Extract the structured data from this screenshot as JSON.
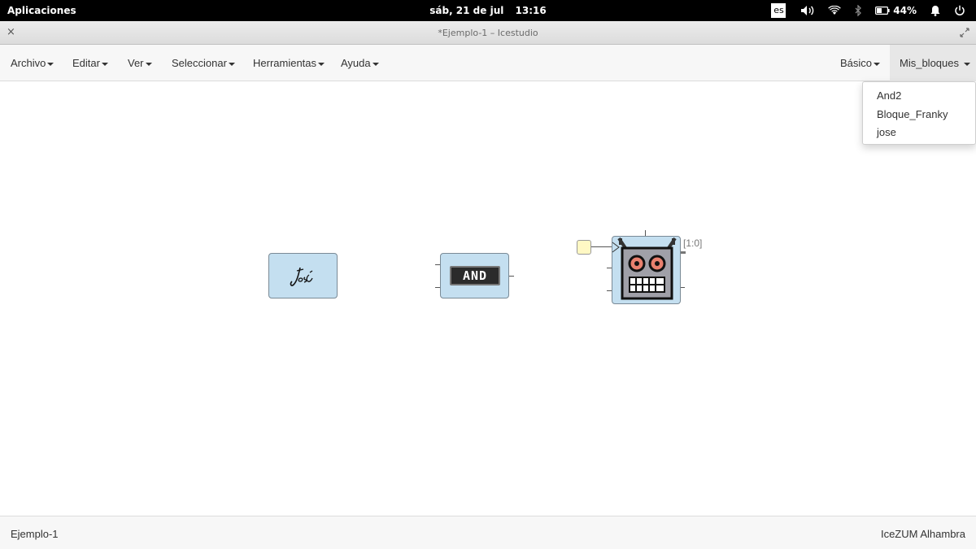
{
  "topbar": {
    "applications": "Aplicaciones",
    "date": "sáb, 21 de jul",
    "time": "13:16",
    "keyboard_layout": "es",
    "battery_percent": "44%",
    "icons": [
      "volume-icon",
      "wifi-icon",
      "bluetooth-icon",
      "battery-icon",
      "notifications-icon",
      "power-icon"
    ]
  },
  "window": {
    "title": "*Ejemplo-1 – Icestudio",
    "close_glyph": "×"
  },
  "menubar": {
    "items": [
      {
        "label": "Archivo"
      },
      {
        "label": "Editar"
      },
      {
        "label": "Ver"
      },
      {
        "label": "Seleccionar"
      },
      {
        "label": "Herramientas"
      },
      {
        "label": "Ayuda"
      }
    ],
    "right_items": [
      {
        "label": "Básico"
      },
      {
        "label": "Mis_bloques",
        "active": true
      }
    ]
  },
  "dropdown": {
    "items": [
      "And2",
      "Bloque_Franky",
      "jose"
    ]
  },
  "canvas": {
    "blocks": [
      {
        "name": "jose-block",
        "icon": "signature-icon",
        "text": "José"
      },
      {
        "name": "and2-block",
        "icon": "and-gate-icon",
        "text": "AND"
      },
      {
        "name": "bloque-franky-block",
        "icon": "robot-icon",
        "output_label": "[1:0]"
      }
    ],
    "input_port_color": "#fff8c4"
  },
  "footer": {
    "project_name": "Ejemplo-1",
    "board_name": "IceZUM Alhambra"
  },
  "colors": {
    "block_fill": "#c4dff0",
    "robot_face": "#a0a0a8",
    "robot_eye": "#e8806e"
  }
}
